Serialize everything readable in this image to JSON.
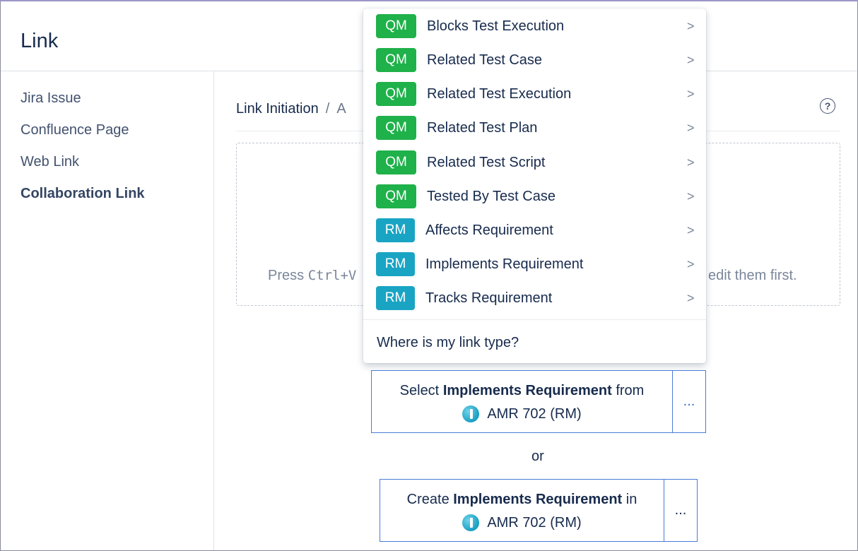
{
  "header": {
    "title": "Link"
  },
  "sidebar": {
    "items": [
      {
        "label": "Jira Issue"
      },
      {
        "label": "Confluence Page"
      },
      {
        "label": "Web Link"
      },
      {
        "label": "Collaboration Link"
      }
    ]
  },
  "breadcrumb": {
    "current": "Link Initiation",
    "separator": "/",
    "next_partial": "A"
  },
  "dropzone": {
    "hint_left": "Press ",
    "hint_key": "Ctrl+V",
    "hint_right": "edit them first."
  },
  "menu": {
    "items": [
      {
        "badge": "QM",
        "label": "Blocks Test Execution"
      },
      {
        "badge": "QM",
        "label": "Related Test Case"
      },
      {
        "badge": "QM",
        "label": "Related Test Execution"
      },
      {
        "badge": "QM",
        "label": "Related Test Plan"
      },
      {
        "badge": "QM",
        "label": "Related Test Script"
      },
      {
        "badge": "QM",
        "label": "Tested By Test Case"
      },
      {
        "badge": "RM",
        "label": "Affects Requirement"
      },
      {
        "badge": "RM",
        "label": "Implements Requirement"
      },
      {
        "badge": "RM",
        "label": "Tracks Requirement"
      }
    ],
    "chevron": ">",
    "footer": "Where is my link type?"
  },
  "select_action": {
    "prefix": "Select ",
    "link_type": "Implements Requirement",
    "suffix": " from",
    "project": "AMR 702 (RM)",
    "more": "..."
  },
  "or_text": "or",
  "create_action": {
    "prefix": "Create ",
    "link_type": "Implements Requirement",
    "suffix": " in",
    "project": "AMR 702 (RM)",
    "more": "..."
  },
  "colors": {
    "qm_badge": "#1fb14a",
    "rm_badge": "#1aa4c4",
    "action_border": "#4a7bd8"
  }
}
